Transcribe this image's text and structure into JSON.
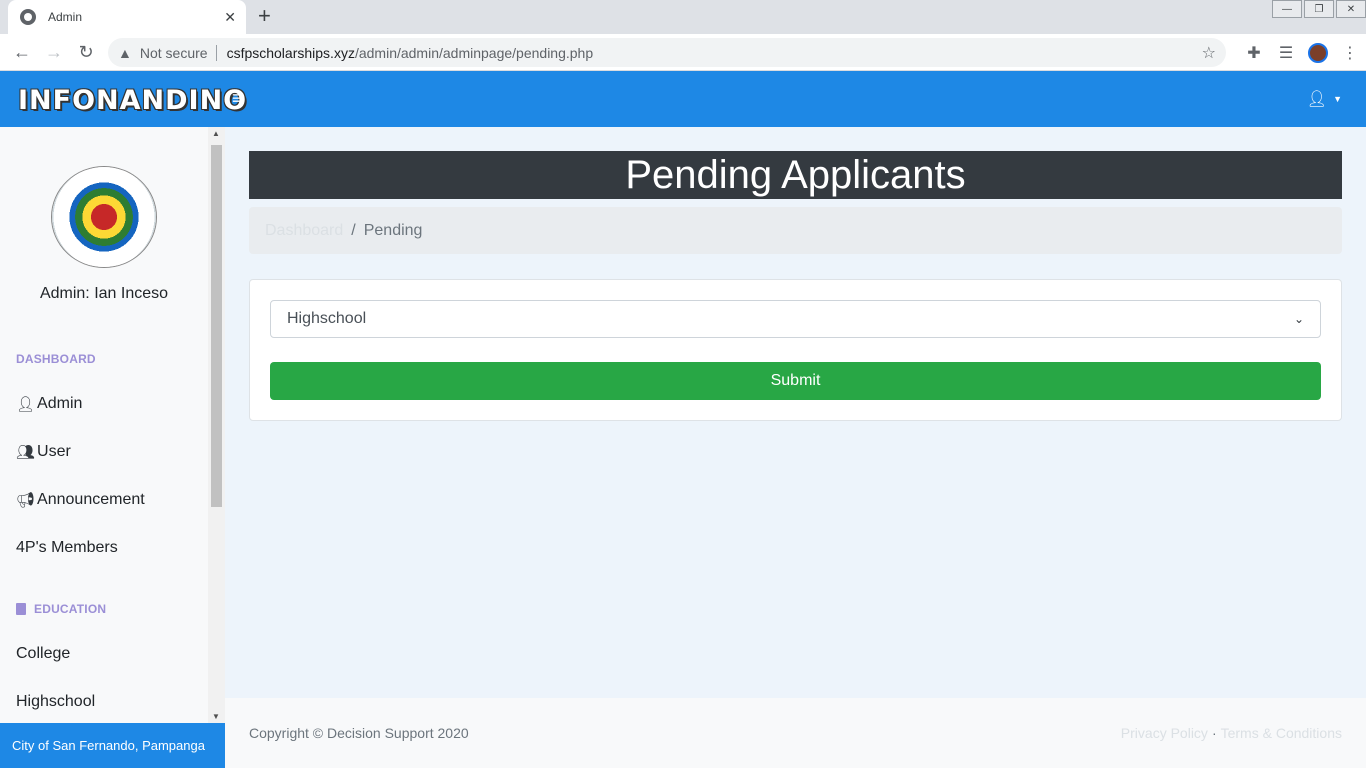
{
  "browser": {
    "tab_title": "Admin",
    "tab_close": "✕",
    "new_tab": "+",
    "security_label": "Not secure",
    "url_host": "csfpscholarships.xyz",
    "url_path": "/admin/admin/adminpage/pending.php"
  },
  "navbar": {
    "brand": "INFONANDINO",
    "hamburger": "≡"
  },
  "sidebar": {
    "admin_name": "Admin: Ian Inceso",
    "dashboard_heading": "DASHBOARD",
    "items": [
      {
        "label": "Admin",
        "icon": "user-icon"
      },
      {
        "label": "User",
        "icon": "users-icon"
      },
      {
        "label": "Announcement",
        "icon": "megaphone-icon"
      },
      {
        "label": "4P's Members",
        "icon": ""
      }
    ],
    "education_heading": "EDUCATION",
    "education_items": [
      {
        "label": "College"
      },
      {
        "label": "Highschool"
      }
    ],
    "footer": "City of San Fernando, Pampanga"
  },
  "main": {
    "title": "Pending Applicants",
    "breadcrumb": {
      "link": "Dashboard",
      "divider": "/",
      "active": "Pending"
    },
    "select_value": "Highschool",
    "submit_label": "Submit"
  },
  "footer": {
    "copyright": "Copyright © Decision Support 2020",
    "privacy": "Privacy Policy",
    "dot": "·",
    "terms": "Terms & Conditions"
  },
  "colors": {
    "navbar": "#1e88e5",
    "title_bar": "#343a40",
    "submit": "#28a745",
    "heading": "#9b8fd6"
  }
}
